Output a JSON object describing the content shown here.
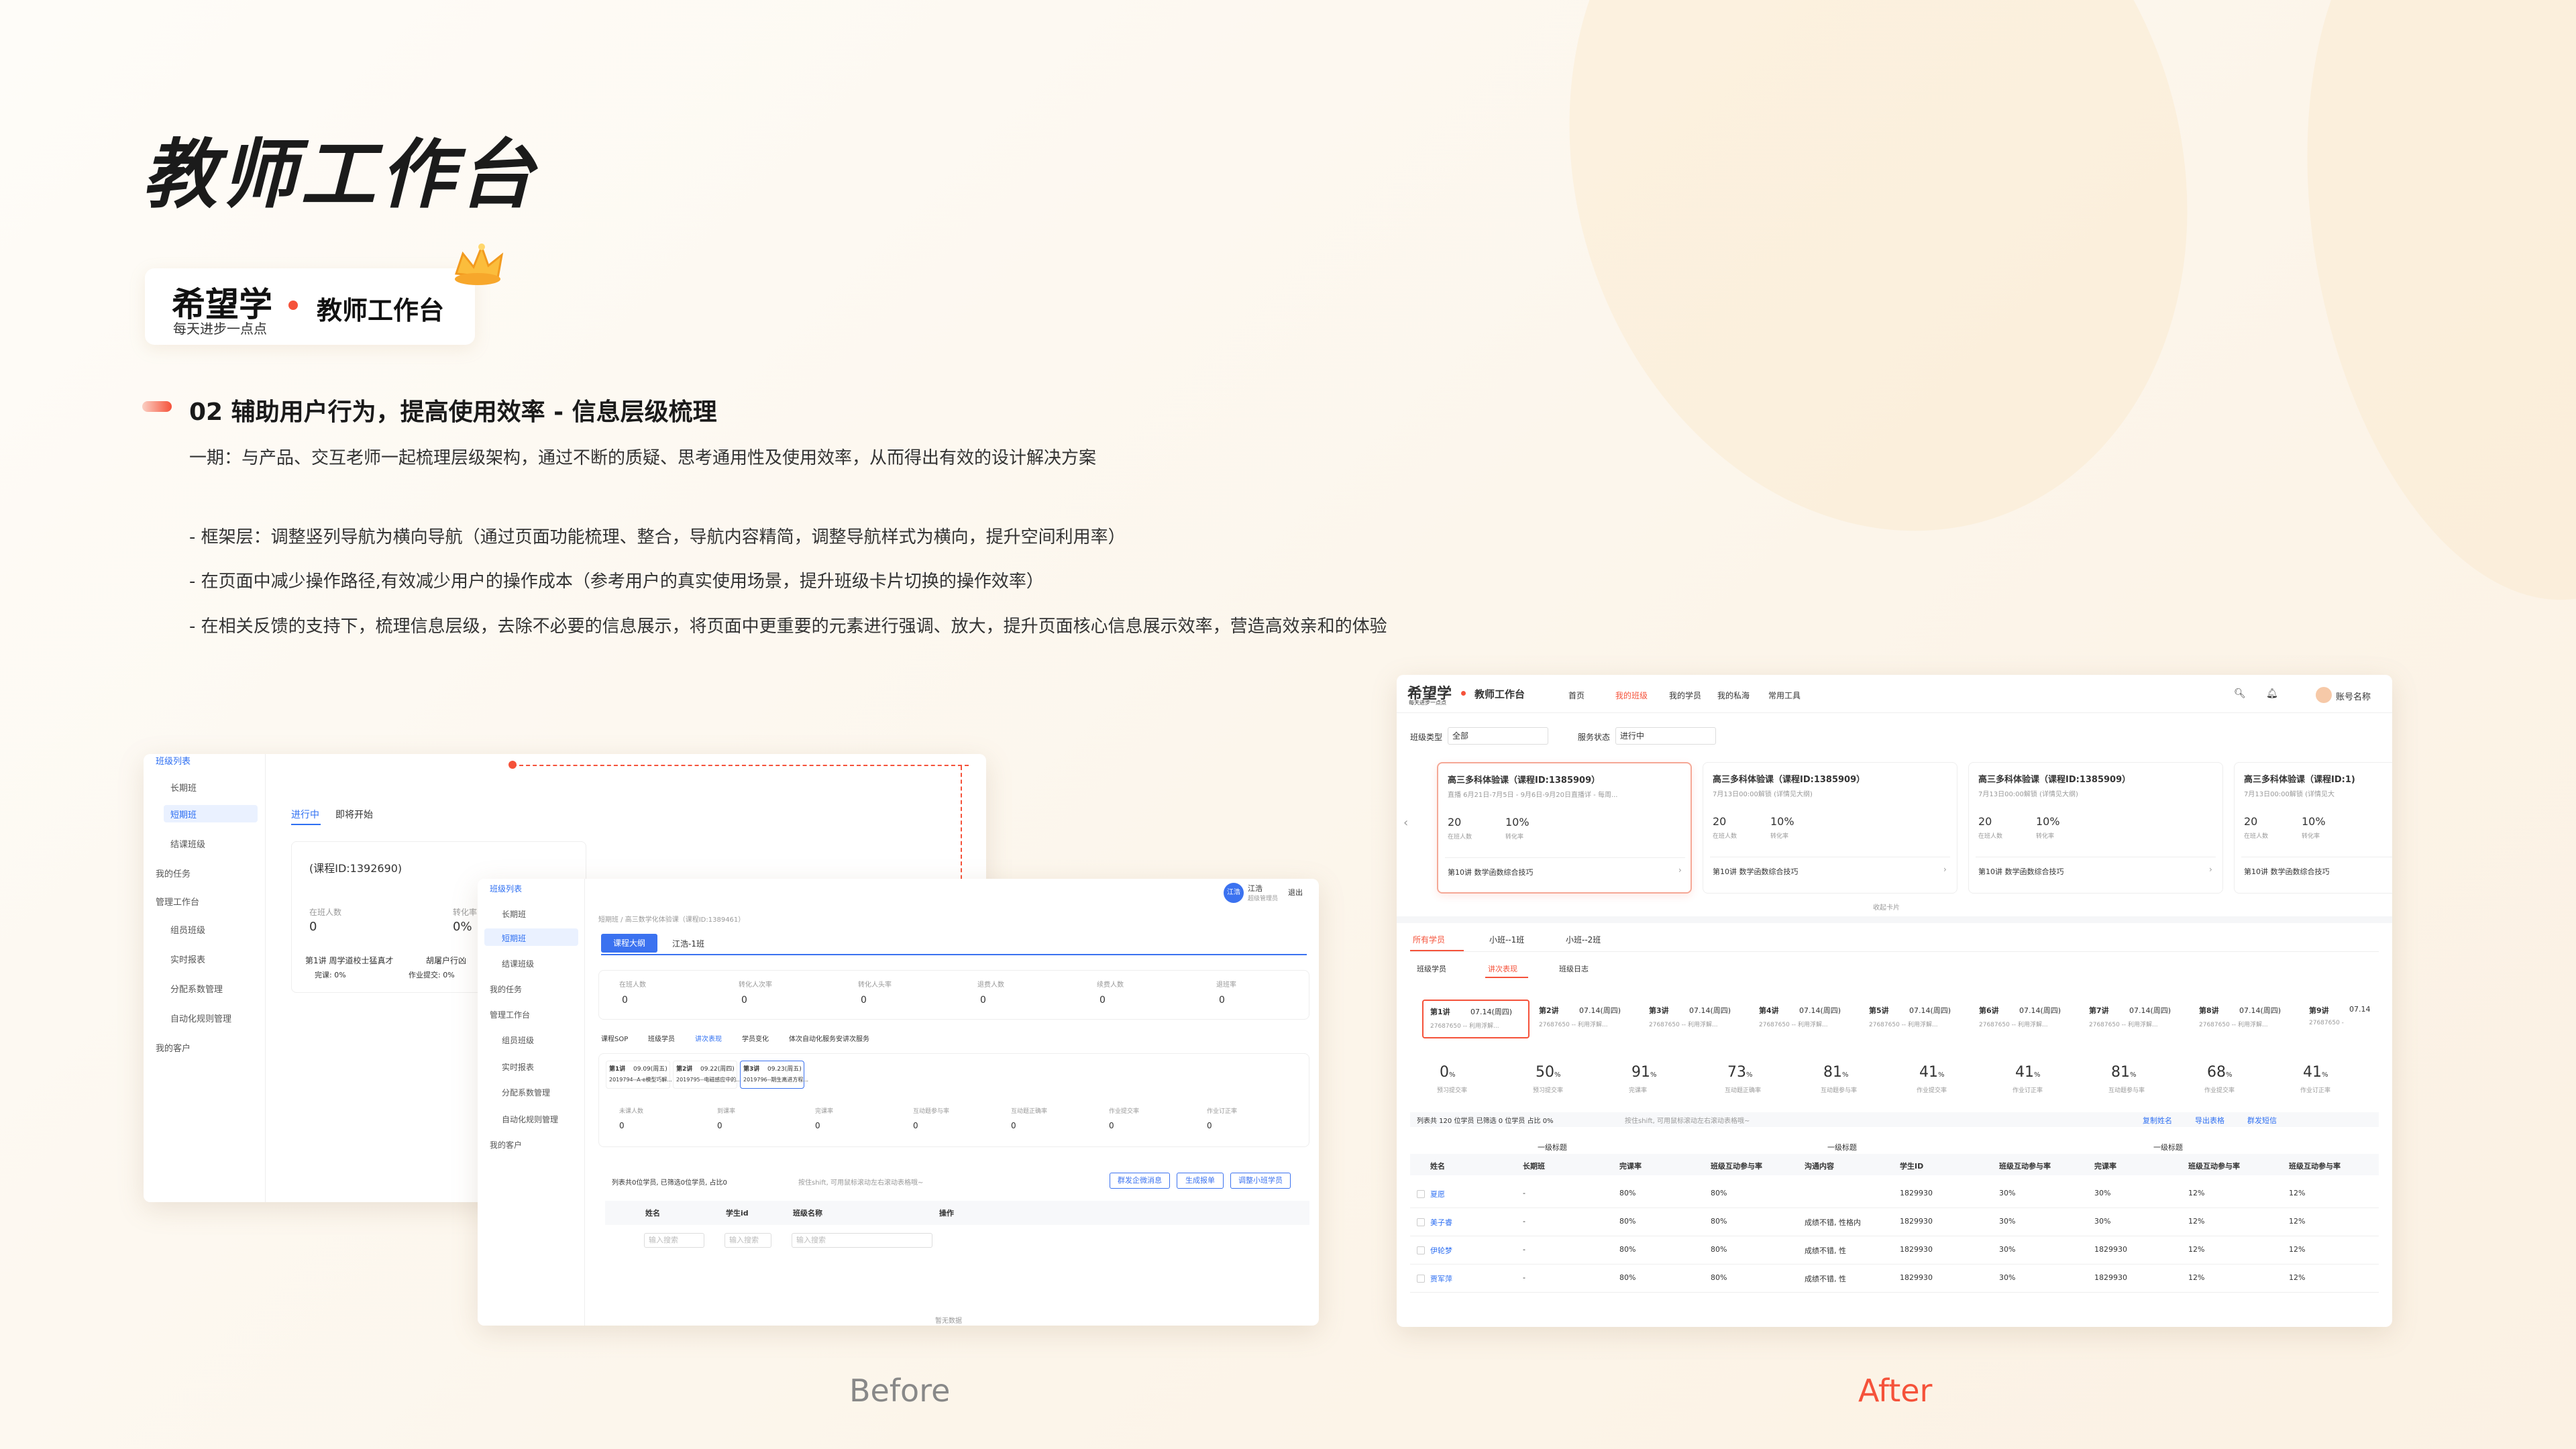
{
  "page": {
    "title": "教师工作台",
    "logo": {
      "brand": "希望学",
      "slogan": "每天进步一点点",
      "product": "教师工作台"
    },
    "section": {
      "title": "02 辅助用户行为，提高使用效率 - 信息层级梳理",
      "intro": "一期：与产品、交互老师一起梳理层级架构，通过不断的质疑、思考通用性及使用效率，从而得出有效的设计解决方案",
      "bullets": [
        "- 框架层：调整竖列导航为横向导航（通过页面功能梳理、整合，导航内容精简，调整导航样式为横向，提升空间利用率）",
        "- 在页面中减少操作路径,有效减少用户的操作成本（参考用户的真实使用场景，提升班级卡片切换的操作效率）",
        "- 在相关反馈的支持下，梳理信息层级，去除不必要的信息展示，将页面中更重要的元素进行强调、放大，提升页面核心信息展示效率，营造高效亲和的体验"
      ]
    },
    "captions": {
      "before": "Before",
      "after": "After"
    },
    "accent": "#f5523a",
    "blue": "#2e6ff2"
  },
  "before_back": {
    "nav": [
      "班级列表",
      "长期班",
      "短期班",
      "结课班级",
      "我的任务",
      "管理工作台",
      "组员班级",
      "实时报表",
      "分配系数管理",
      "自动化规则管理",
      "我的客户"
    ],
    "tabs": [
      "进行中",
      "即将开始"
    ],
    "course_id": "(课程ID:1392690)",
    "stats": [
      {
        "label": "在班人数",
        "value": "0"
      },
      {
        "label": "转化率",
        "value": "0%"
      }
    ],
    "lesson": "第1讲 周学道校士猛真才",
    "lesson2": "胡屠户行凶",
    "done": "完课: 0%",
    "homework": "作业提交: 0%"
  },
  "before_front": {
    "nav": [
      "班级列表",
      "长期班",
      "短期班",
      "结课班级",
      "我的任务",
      "管理工作台",
      "组员班级",
      "实时报表",
      "分配系数管理",
      "自动化规则管理",
      "我的客户"
    ],
    "user": {
      "avatar": "江浩",
      "name": "江浩",
      "role": "超级管理员",
      "logout": "退出"
    },
    "breadcrumb": "短期班 / 高三数学化体验课（课程ID:1389461）",
    "tabs": [
      "课程大纲",
      "江浩-1班"
    ],
    "stats": [
      {
        "label": "在班人数",
        "value": "0"
      },
      {
        "label": "转化人次率",
        "value": "0"
      },
      {
        "label": "转化人头率",
        "value": "0"
      },
      {
        "label": "退费人数",
        "value": "0"
      },
      {
        "label": "续费人数",
        "value": "0"
      },
      {
        "label": "退班率",
        "value": "0"
      }
    ],
    "subtabs": [
      "课程SOP",
      "班级学员",
      "讲次表现",
      "学员变化",
      "体次自动化服务",
      "安讲次服务"
    ],
    "lessons": [
      {
        "n": "第1讲",
        "d": "09.09(周五)",
        "s": "2019794--A-e模型巧解..."
      },
      {
        "n": "第2讲",
        "d": "09.22(周四)",
        "s": "2019795--电磁感应中的..."
      },
      {
        "n": "第3讲",
        "d": "09.23(周五)",
        "s": "2019796--期生离进方程..."
      }
    ],
    "lstats": [
      {
        "label": "未课人数",
        "value": "0"
      },
      {
        "label": "到课率",
        "value": "0"
      },
      {
        "label": "完课率",
        "value": "0"
      },
      {
        "label": "互动题参与率",
        "value": "0"
      },
      {
        "label": "互动题正确率",
        "value": "0"
      },
      {
        "label": "作业提交率",
        "value": "0"
      },
      {
        "label": "作业订正率",
        "value": "0"
      }
    ],
    "toolbar": "列表共0位学员, 已筛选0位学员, 占比0",
    "toolbar2": "按住shift, 可用鼠标滚动左右滚动表格哦~",
    "btns": [
      "群发企微消息",
      "生成报单",
      "调整小班学员"
    ],
    "cols": [
      "姓名",
      "学生id",
      "班级名称",
      "操作"
    ],
    "placeholders": [
      "输入搜索",
      "输入搜索",
      "输入搜索"
    ],
    "empty": "暂无数据"
  },
  "after": {
    "brand": "希望学",
    "slogan": "每天进步一点点",
    "product": "教师工作台",
    "nav": [
      "首页",
      "我的班级",
      "我的学员",
      "我的私海",
      "常用工具"
    ],
    "account": "账号名称",
    "filters": [
      {
        "label": "班级类型",
        "value": "全部"
      },
      {
        "label": "服务状态",
        "value": "进行中"
      }
    ],
    "cards": [
      {
        "title": "高三多科体验课（课程ID:1385909）",
        "sub": "直播 6月21日-7月5日 - 9月6日-9月20日直播详 - 每周...",
        "stats": [
          {
            "v": "20",
            "l": "在班人数"
          },
          {
            "v": "10%",
            "l": "转化率"
          }
        ],
        "lesson": "第10讲 数学函数综合技巧"
      },
      {
        "title": "高三多科体验课（课程ID:1385909）",
        "sub": "7月13日00:00解锁  (详情见大纲)",
        "stats": [
          {
            "v": "20",
            "l": "在班人数"
          },
          {
            "v": "10%",
            "l": "转化率"
          }
        ],
        "lesson": "第10讲 数学函数综合技巧"
      },
      {
        "title": "高三多科体验课（课程ID:1385909）",
        "sub": "7月13日00:00解锁  (详情见大纲)",
        "stats": [
          {
            "v": "20",
            "l": "在班人数"
          },
          {
            "v": "10%",
            "l": "转化率"
          }
        ],
        "lesson": "第10讲 数学函数综合技巧"
      },
      {
        "title": "高三多科体验课（课程ID:1)",
        "sub": "7月13日00:00解锁 (详情见大",
        "stats": [
          {
            "v": "20",
            "l": "在班人数"
          },
          {
            "v": "10%",
            "l": "转化率"
          }
        ],
        "lesson": "第10讲 数学函数综合技巧"
      }
    ],
    "collapse": "收起卡片",
    "class_tabs": [
      "所有学员",
      "小班--1班",
      "小班--2班"
    ],
    "sub_tabs": [
      "班级学员",
      "讲次表现",
      "班级日志"
    ],
    "lessons": [
      {
        "n": "第1讲",
        "d": "07.14(周四)",
        "s": "27687650 -- 利用浮解..."
      },
      {
        "n": "第2讲",
        "d": "07.14(周四)",
        "s": "27687650 -- 利用浮解..."
      },
      {
        "n": "第3讲",
        "d": "07.14(周四)",
        "s": "27687650 -- 利用浮解..."
      },
      {
        "n": "第4讲",
        "d": "07.14(周四)",
        "s": "27687650 -- 利用浮解..."
      },
      {
        "n": "第5讲",
        "d": "07.14(周四)",
        "s": "27687650 -- 利用浮解..."
      },
      {
        "n": "第6讲",
        "d": "07.14(周四)",
        "s": "27687650 -- 利用浮解..."
      },
      {
        "n": "第7讲",
        "d": "07.14(周四)",
        "s": "27687650 -- 利用浮解..."
      },
      {
        "n": "第8讲",
        "d": "07.14(周四)",
        "s": "27687650 -- 利用浮解..."
      },
      {
        "n": "第9讲",
        "d": "07.14",
        "s": "27687650 -"
      }
    ],
    "metrics": [
      {
        "v": "0",
        "u": "%",
        "l": "预习提交率"
      },
      {
        "v": "50",
        "u": "%",
        "l": "预习提交率"
      },
      {
        "v": "91",
        "u": "%",
        "l": "完课率"
      },
      {
        "v": "73",
        "u": "%",
        "l": "互动题正确率"
      },
      {
        "v": "81",
        "u": "%",
        "l": "互动题参与率"
      },
      {
        "v": "41",
        "u": "%",
        "l": "作业提交率"
      },
      {
        "v": "41",
        "u": "%",
        "l": "作业订正率"
      },
      {
        "v": "81",
        "u": "%",
        "l": "互动题参与率"
      },
      {
        "v": "68",
        "u": "%",
        "l": "作业提交率"
      },
      {
        "v": "41",
        "u": "%",
        "l": "作业订正率"
      }
    ],
    "summary": "列表共 120 位学员   已筛选 0 位学员   占比 0%",
    "hint": "按住shift, 可用鼠标滚动左右滚动表格哦~",
    "actions": [
      "复制姓名",
      "导出表格",
      "群发短信"
    ],
    "group_headers": [
      "一级标题",
      "一级标题",
      "一级标题"
    ],
    "columns": [
      "姓名",
      "长期班",
      "完课率",
      "班级互动参与率",
      "沟通内容",
      "学生ID",
      "班级互动参与率",
      "完课率",
      "班级互动参与率",
      "班级互动参与率"
    ],
    "rows": [
      {
        "name": "夏愿",
        "c": [
          "-",
          "80%",
          "80%",
          "",
          "1829930",
          "30%",
          "30%",
          "12%",
          "12%"
        ]
      },
      {
        "name": "美子睿",
        "c": [
          "-",
          "80%",
          "80%",
          "成绩不错, 性格内",
          "1829930",
          "30%",
          "30%",
          "12%",
          "12%"
        ]
      },
      {
        "name": "伊轮梦",
        "c": [
          "-",
          "80%",
          "80%",
          "成绩不错, 性",
          "1829930",
          "30%",
          "1829930",
          "12%",
          "12%"
        ]
      },
      {
        "name": "贾军萍",
        "c": [
          "-",
          "80%",
          "80%",
          "成绩不错, 性",
          "1829930",
          "30%",
          "1829930",
          "12%",
          "12%"
        ]
      }
    ]
  }
}
